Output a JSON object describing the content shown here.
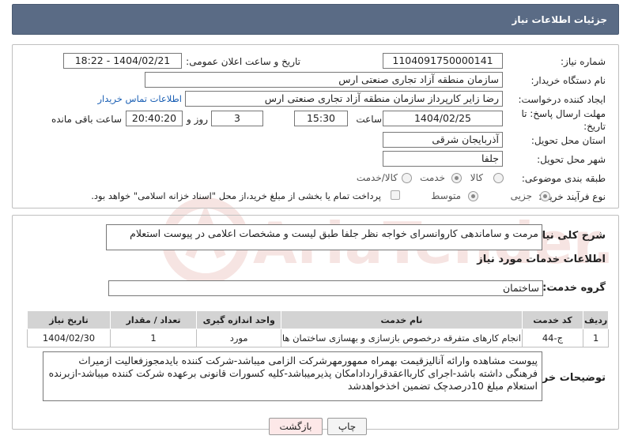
{
  "header": {
    "title": "جزئیات اطلاعات نیاز"
  },
  "form": {
    "need_number_label": "شماره نیاز:",
    "need_number": "1104091750000141",
    "announce_label": "تاریخ و ساعت اعلان عمومی:",
    "announce_value": "1404/02/21 - 18:22",
    "buyer_org_label": "نام دستگاه خریدار:",
    "buyer_org": "سازمان منطقه آزاد تجاری صنعتی ارس",
    "creator_label": "ایجاد کننده درخواست:",
    "creator": "رضا زایر کارپرداز سازمان منطقه آزاد تجاری صنعتی ارس",
    "contact_link": "اطلاعات تماس خریدار",
    "deadline_label_1": "مهلت ارسال پاسخ: تا",
    "deadline_label_2": "تاریخ:",
    "deadline_date": "1404/02/25",
    "time_label": "ساعت",
    "deadline_time": "15:30",
    "days_value": "3",
    "days_label": "روز و",
    "remaining_time": "20:40:20",
    "remaining_label": "ساعت باقی مانده",
    "province_label": "استان محل تحویل:",
    "province": "آذربایجان شرقی",
    "city_label": "شهر محل تحویل:",
    "city": "جلفا",
    "category_label": "طبقه بندی موضوعی:",
    "category_options": [
      "کالا",
      "خدمت",
      "کالا/خدمت"
    ],
    "category_selected": "خدمت",
    "process_label": "نوع فرآیند خرید :",
    "process_options": [
      "جزیی",
      "متوسط"
    ],
    "process_selected": "جزیی",
    "payment_note": "پرداخت تمام یا بخشی از مبلغ خرید،از محل \"اسناد خزانه اسلامی\" خواهد بود."
  },
  "summary": {
    "label": "شرح کلی نیاز:",
    "text": "مرمت و ساماندهی کاروانسرای خواجه نظر جلفا طبق لیست و مشخصات اعلامی در پیوست استعلام"
  },
  "services": {
    "section_title": "اطلاعات خدمات مورد نیاز",
    "group_label": "گروه خدمت:",
    "group_value": "ساختمان",
    "columns": [
      "ردیف",
      "کد خدمت",
      "نام خدمت",
      "واحد اندازه گیری",
      "تعداد / مقدار",
      "تاریخ نیاز"
    ],
    "rows": [
      [
        "1",
        "ج-44",
        "انجام کارهای متفرقه درخصوص بازسازی و بهسازی ساختمان ها",
        "مورد",
        "1",
        "1404/02/30"
      ]
    ]
  },
  "buyer_notes": {
    "label": "توضیحات خریدار:",
    "text": "پیوست مشاهده وارائه آنالیزقیمت بهمراه ممهورمهرشرکت الزامی میباشد-شرکت کننده بایدمجوزفعالیت ازمیراث فرهنگی داشته باشد-اجرای کاربااعقدقراردادامکان پذیرمیباشد-کلیه کسورات قانونی برعهده شرکت کننده میباشد-ازبرنده استعلام مبلغ 10درصدچک تضمین اخذخواهدشد"
  },
  "buttons": {
    "print": "چاپ",
    "back": "بازگشت"
  },
  "watermark": "AriaTender.neT",
  "colors": {
    "header": "#5a6b85",
    "link": "#1a5fb4",
    "back_button": "#fde8e8"
  }
}
